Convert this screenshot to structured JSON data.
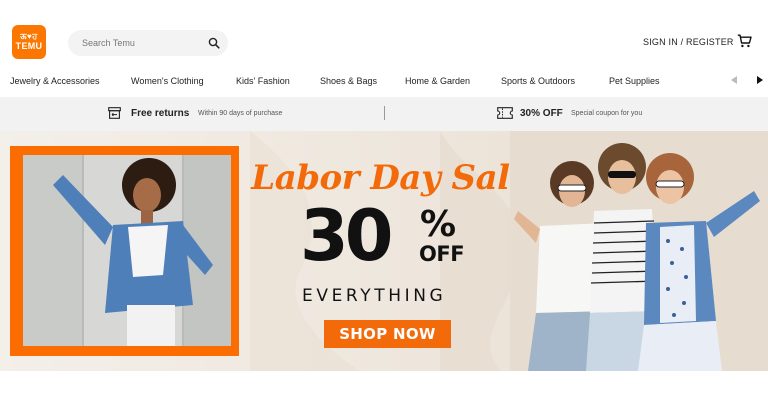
{
  "brand": {
    "logo_top": "ऊ❤︎ਹ",
    "logo_bottom": "TEMU",
    "accent": "#fb7701"
  },
  "search": {
    "placeholder": "Search Temu",
    "value": "",
    "icon": "search-icon"
  },
  "header": {
    "signin_label": "SIGN IN / REGISTER",
    "cart_icon": "cart-icon"
  },
  "categories": [
    "Jewelry & Accessories",
    "Women's Clothing",
    "Kids' Fashion",
    "Shoes & Bags",
    "Home & Garden",
    "Sports & Outdoors",
    "Pet Supplies"
  ],
  "infobar": {
    "returns_title": "Free returns",
    "returns_sub": "Within 90 days of purchase",
    "coupon_title": "30% OFF",
    "coupon_sub": "Special coupon for you"
  },
  "banner": {
    "headline": "Labor Day Sale",
    "percent": "30",
    "percent_sign": "%",
    "off": "OFF",
    "everything": "EVERYTHING",
    "cta": "SHOP NOW",
    "headline_color": "#f26a0a",
    "frame_color": "#fb6d00"
  }
}
